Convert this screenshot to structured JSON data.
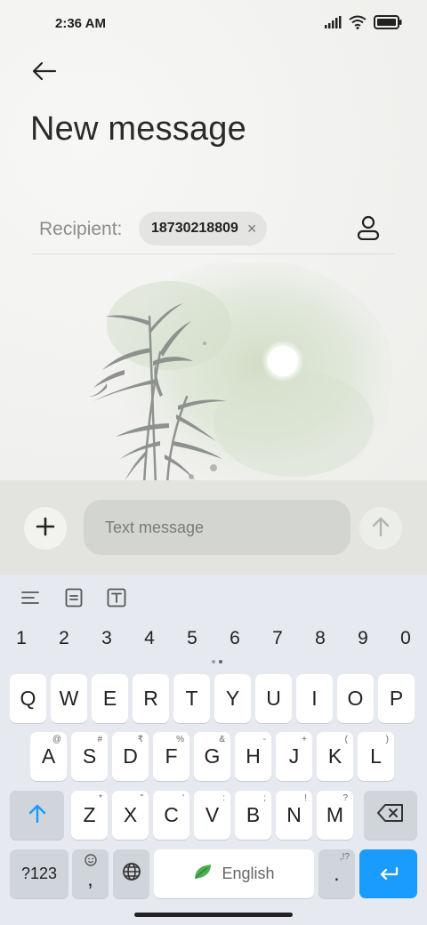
{
  "status_bar": {
    "time": "2:36 AM",
    "icons": [
      "signal-icon",
      "wifi-icon",
      "battery-icon"
    ]
  },
  "header": {
    "title": "New message",
    "back_icon": "arrow-left-icon"
  },
  "recipient": {
    "label": "Recipient:",
    "chip_value": "18730218809",
    "remove_glyph": "×",
    "contact_icon": "person-icon"
  },
  "background_art": "bamboo-moon-ink-painting",
  "compose": {
    "placeholder": "Text message",
    "value": "",
    "add_icon": "plus-icon",
    "send_icon": "arrow-up-icon"
  },
  "keyboard": {
    "toolbar": [
      "lines-icon",
      "document-icon",
      "text-box-icon"
    ],
    "numbers": [
      "1",
      "2",
      "3",
      "4",
      "5",
      "6",
      "7",
      "8",
      "9",
      "0"
    ],
    "row1": [
      "Q",
      "W",
      "E",
      "R",
      "T",
      "Y",
      "U",
      "I",
      "O",
      "P"
    ],
    "row2": [
      {
        "k": "A",
        "s": "@"
      },
      {
        "k": "S",
        "s": "#"
      },
      {
        "k": "D",
        "s": "₹"
      },
      {
        "k": "F",
        "s": "%"
      },
      {
        "k": "G",
        "s": "&"
      },
      {
        "k": "H",
        "s": "-"
      },
      {
        "k": "J",
        "s": "+"
      },
      {
        "k": "K",
        "s": "("
      },
      {
        "k": "L",
        "s": ")"
      }
    ],
    "row3": [
      {
        "k": "Z",
        "s": "*"
      },
      {
        "k": "X",
        "s": "\""
      },
      {
        "k": "C",
        "s": "'"
      },
      {
        "k": "V",
        "s": ":"
      },
      {
        "k": "B",
        "s": ";"
      },
      {
        "k": "N",
        "s": "!"
      },
      {
        "k": "M",
        "s": "?"
      }
    ],
    "symbols_label": "?123",
    "comma": ",",
    "emoji_icon": "smiley-icon",
    "globe_icon": "globe-icon",
    "space_label": "English",
    "period": ".",
    "period_sup": ",!?",
    "shift_icon": "shift-arrow-icon",
    "backspace_icon": "backspace-icon",
    "enter_icon": "enter-icon",
    "accent": "#1a9cff"
  }
}
